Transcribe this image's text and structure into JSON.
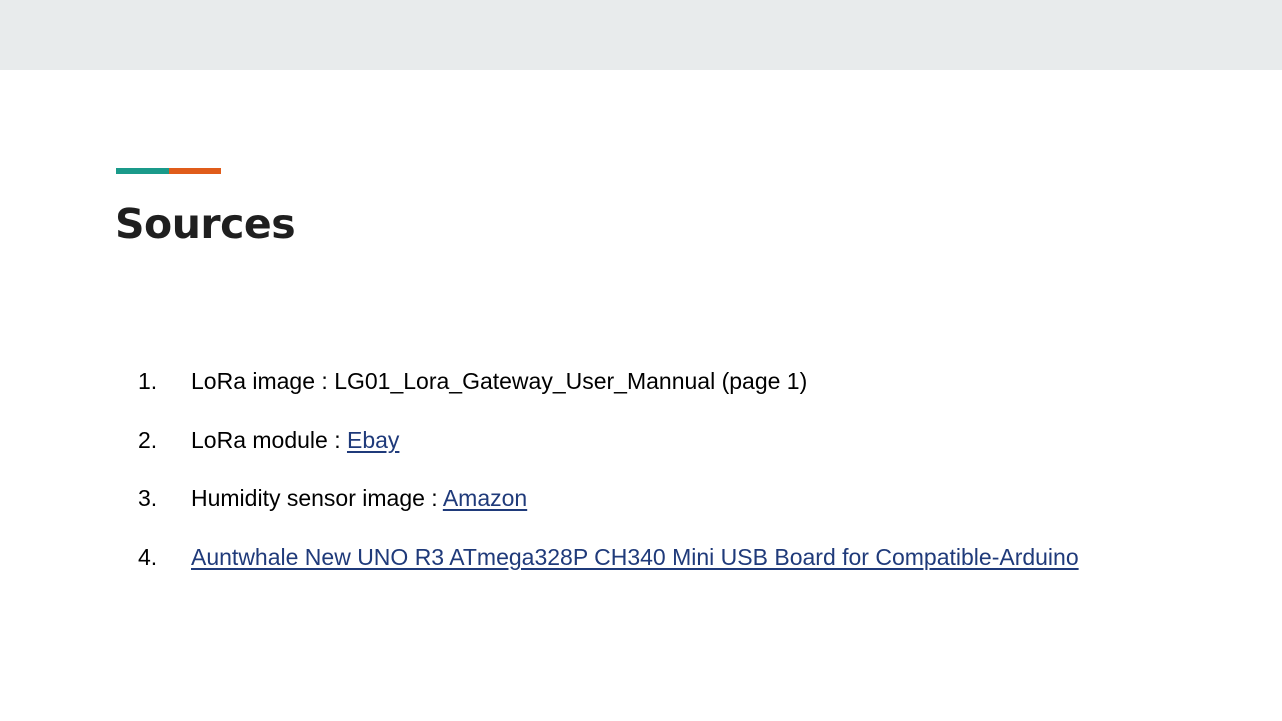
{
  "slide": {
    "title": "Sources",
    "accent_colors": [
      "#1a9a8a",
      "#e05c1a"
    ],
    "items": [
      {
        "number": "1.",
        "prefix": "LoRa image : LG01_Lora_Gateway_User_Mannual (page 1)",
        "link": ""
      },
      {
        "number": "2.",
        "prefix": "LoRa module : ",
        "link": "Ebay"
      },
      {
        "number": "3.",
        "prefix": "Humidity sensor image : ",
        "link": "Amazon"
      },
      {
        "number": "4.",
        "prefix": "",
        "link": "Auntwhale New UNO R3 ATmega328P CH340 Mini USB Board for Compatible-Arduino"
      }
    ],
    "link_color": "#1f3a7a"
  }
}
